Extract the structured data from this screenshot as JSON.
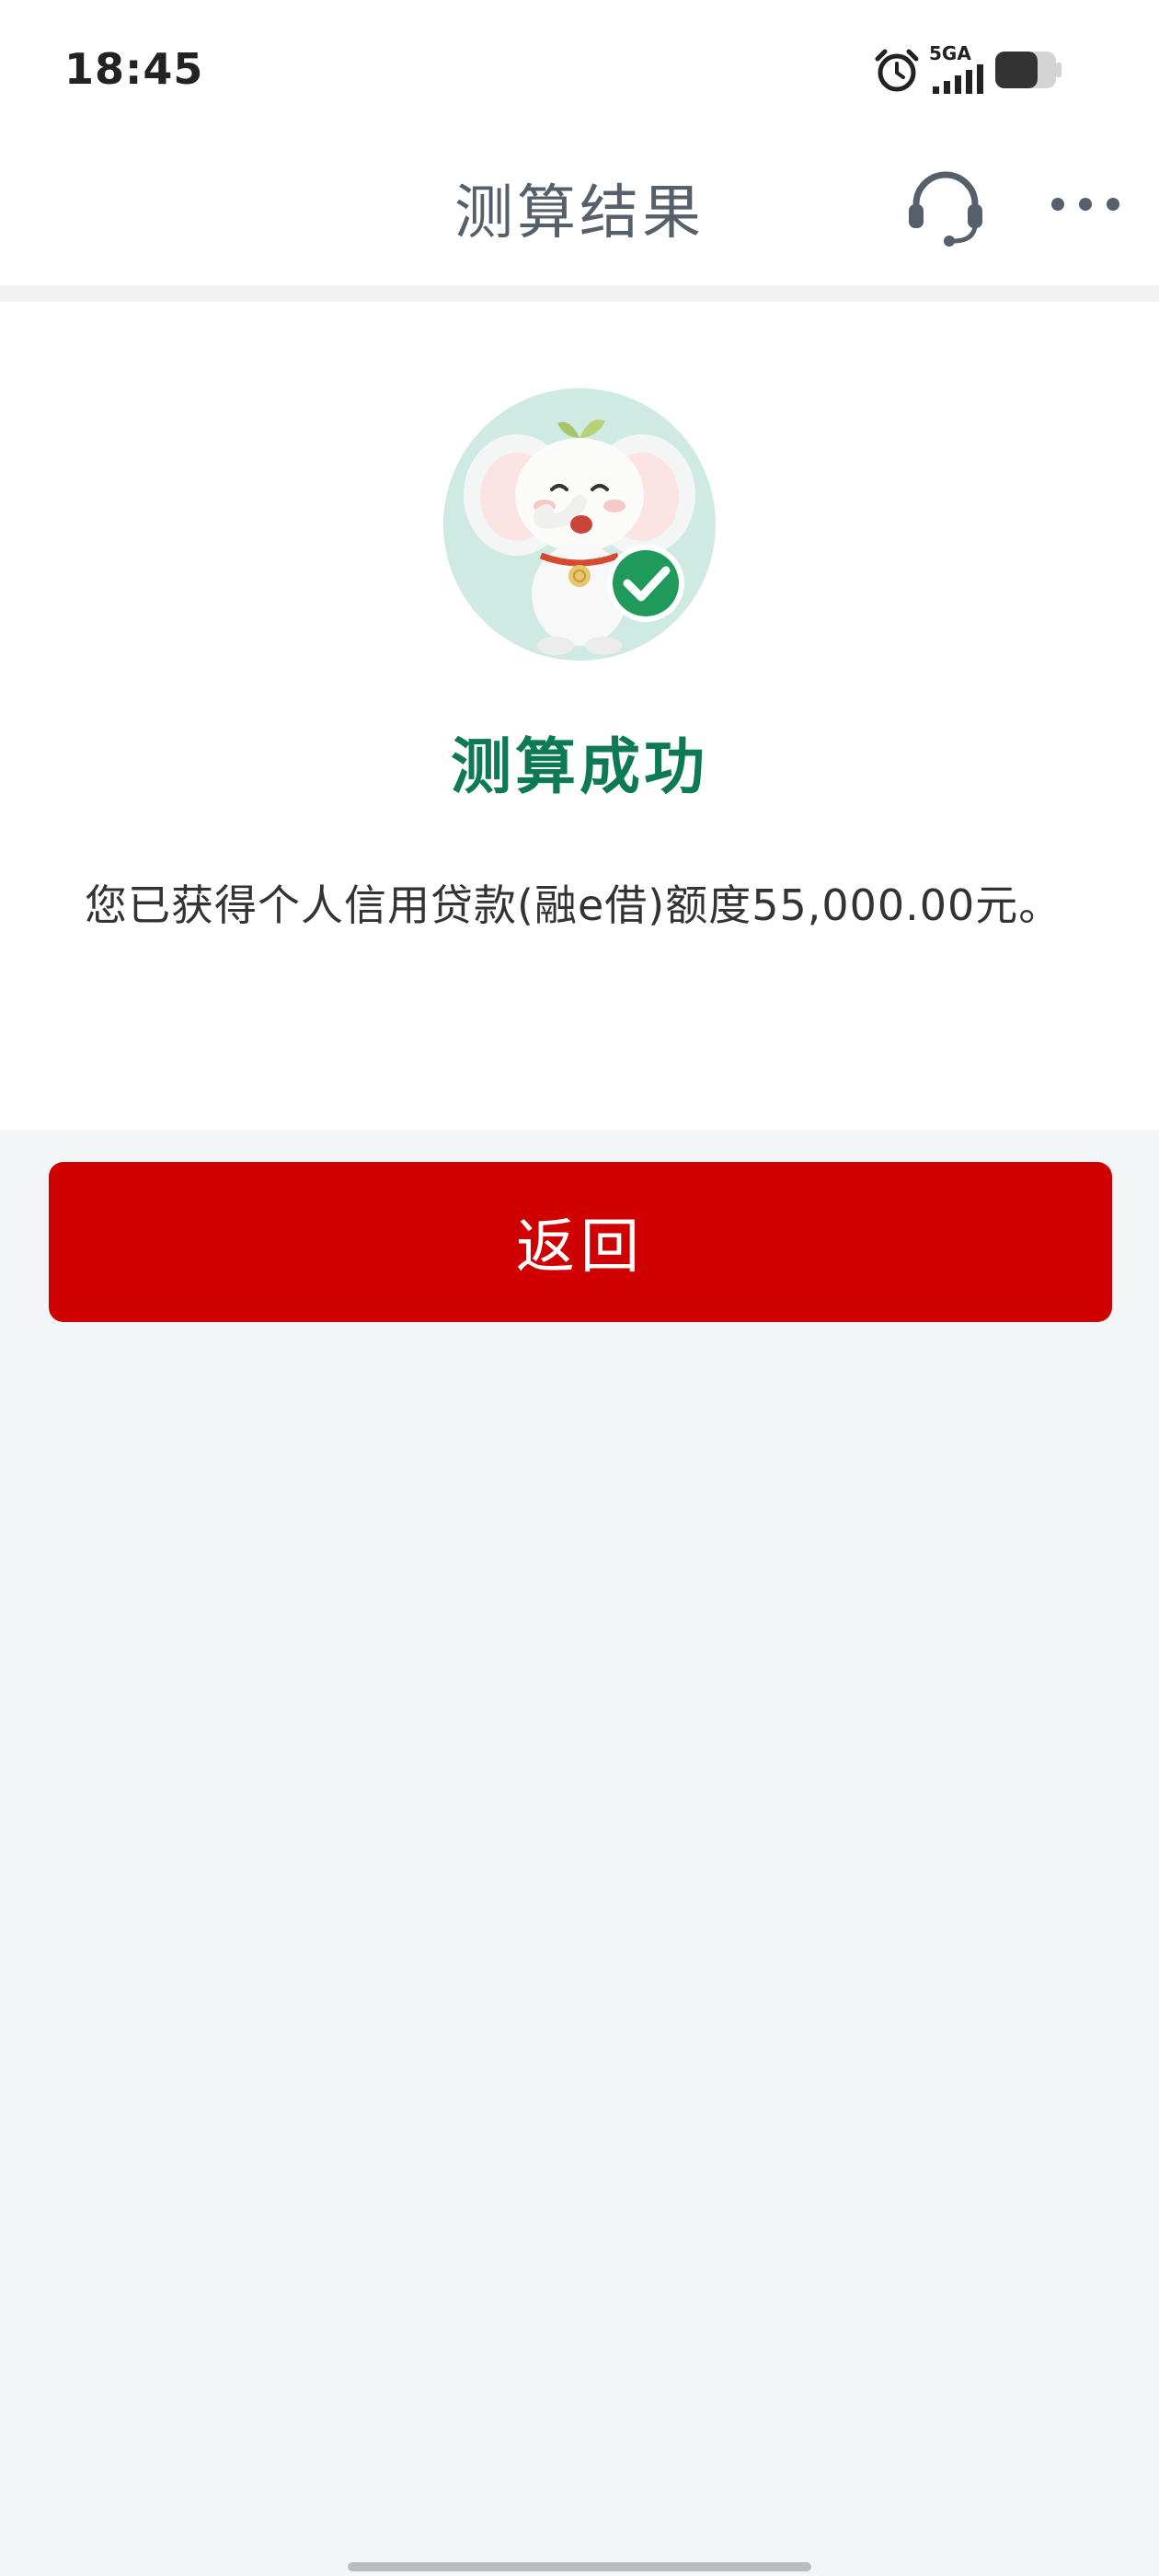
{
  "status_bar": {
    "time": "18:45",
    "network": "5GA",
    "icons": [
      "alarm-icon",
      "signal-icon",
      "battery-icon"
    ]
  },
  "nav": {
    "title": "测算结果",
    "icons": [
      "headset-icon",
      "more-icon"
    ]
  },
  "result": {
    "mascot": "elephant-mascot-with-check",
    "title": "测算成功",
    "message": "您已获得个人信用贷款(融e借)额度55,000.00元。"
  },
  "actions": {
    "back_label": "返回"
  },
  "colors": {
    "accent_green": "#0d7a55",
    "primary_red": "#cf0000",
    "background": "#f4f5f7"
  }
}
